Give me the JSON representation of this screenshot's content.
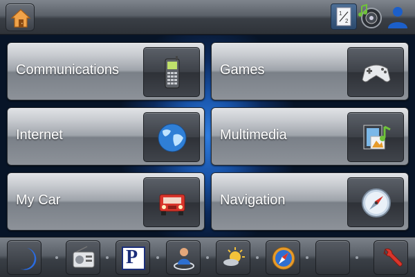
{
  "header": {
    "home_icon": "home-icon",
    "split_icon": "split-screen-icon",
    "media_icon": "media-player-icon",
    "user_icon": "user-icon"
  },
  "tiles": [
    {
      "label": "Communications",
      "icon": "mobile-phone-icon"
    },
    {
      "label": "Games",
      "icon": "gamepad-icon"
    },
    {
      "label": "Internet",
      "icon": "globe-icon"
    },
    {
      "label": "Multimedia",
      "icon": "multimedia-icon"
    },
    {
      "label": "My Car",
      "icon": "car-icon"
    },
    {
      "label": "Navigation",
      "icon": "compass-icon"
    }
  ],
  "dock": {
    "items": [
      "night-mode-icon",
      "radio-icon",
      "parking-icon",
      "user-location-icon",
      "weather-icon",
      "compass-icon",
      "empty-slot",
      "settings-icon"
    ],
    "parking_letter": "P"
  },
  "colors": {
    "accent_blue": "#2f7de0",
    "home_orange": "#e8892b",
    "car_red": "#d9352b"
  }
}
